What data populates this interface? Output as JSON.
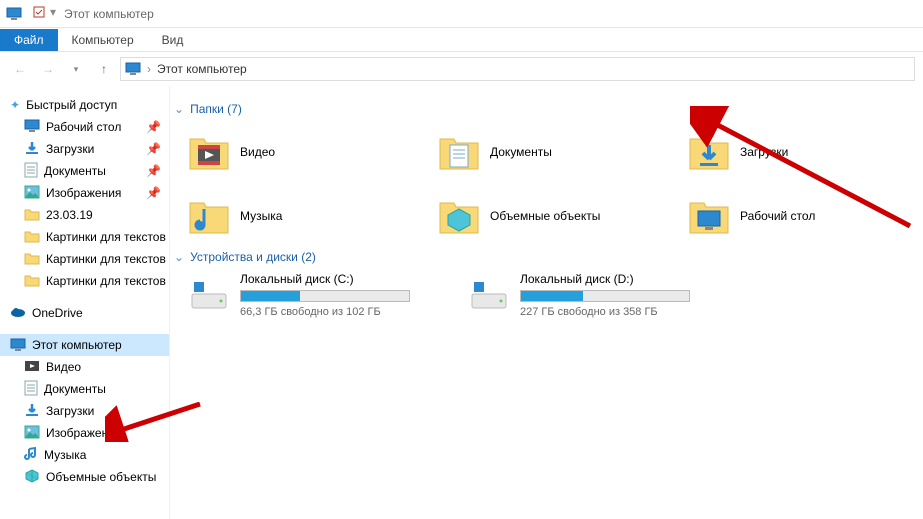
{
  "titlebar": {
    "title": "Этот компьютер"
  },
  "ribbon": {
    "file": "Файл",
    "computer": "Компьютер",
    "view": "Вид"
  },
  "breadcrumb": {
    "root": "Этот компьютер"
  },
  "sidebar": {
    "quick_access": "Быстрый доступ",
    "quick": [
      {
        "label": "Рабочий стол",
        "icon": "desktop",
        "pinned": true
      },
      {
        "label": "Загрузки",
        "icon": "downloads",
        "pinned": true
      },
      {
        "label": "Документы",
        "icon": "documents",
        "pinned": true
      },
      {
        "label": "Изображения",
        "icon": "pictures",
        "pinned": true
      },
      {
        "label": "23.03.19",
        "icon": "folder",
        "pinned": false
      },
      {
        "label": "Картинки для текстов",
        "icon": "folder",
        "pinned": false
      },
      {
        "label": "Картинки для текстов",
        "icon": "folder",
        "pinned": false
      },
      {
        "label": "Картинки для текстов",
        "icon": "folder",
        "pinned": false
      }
    ],
    "onedrive": "OneDrive",
    "this_pc": "Этот компьютер",
    "pc": [
      {
        "label": "Видео",
        "icon": "video"
      },
      {
        "label": "Документы",
        "icon": "documents"
      },
      {
        "label": "Загрузки",
        "icon": "downloads"
      },
      {
        "label": "Изображения",
        "icon": "pictures"
      },
      {
        "label": "Музыка",
        "icon": "music"
      },
      {
        "label": "Объемные объекты",
        "icon": "3d"
      }
    ]
  },
  "main": {
    "folders_header": "Папки (7)",
    "drives_header": "Устройства и диски (2)",
    "folders": [
      {
        "label": "Видео",
        "icon": "video"
      },
      {
        "label": "Документы",
        "icon": "documents"
      },
      {
        "label": "Загрузки",
        "icon": "downloads"
      },
      {
        "label": "Музыка",
        "icon": "music"
      },
      {
        "label": "Объемные объекты",
        "icon": "3d"
      },
      {
        "label": "Рабочий стол",
        "icon": "desktop"
      }
    ],
    "drives": [
      {
        "label": "Локальный диск (C:)",
        "free": "66,3 ГБ свободно из 102 ГБ",
        "fill": 35
      },
      {
        "label": "Локальный диск (D:)",
        "free": "227 ГБ свободно из 358 ГБ",
        "fill": 37
      }
    ]
  }
}
